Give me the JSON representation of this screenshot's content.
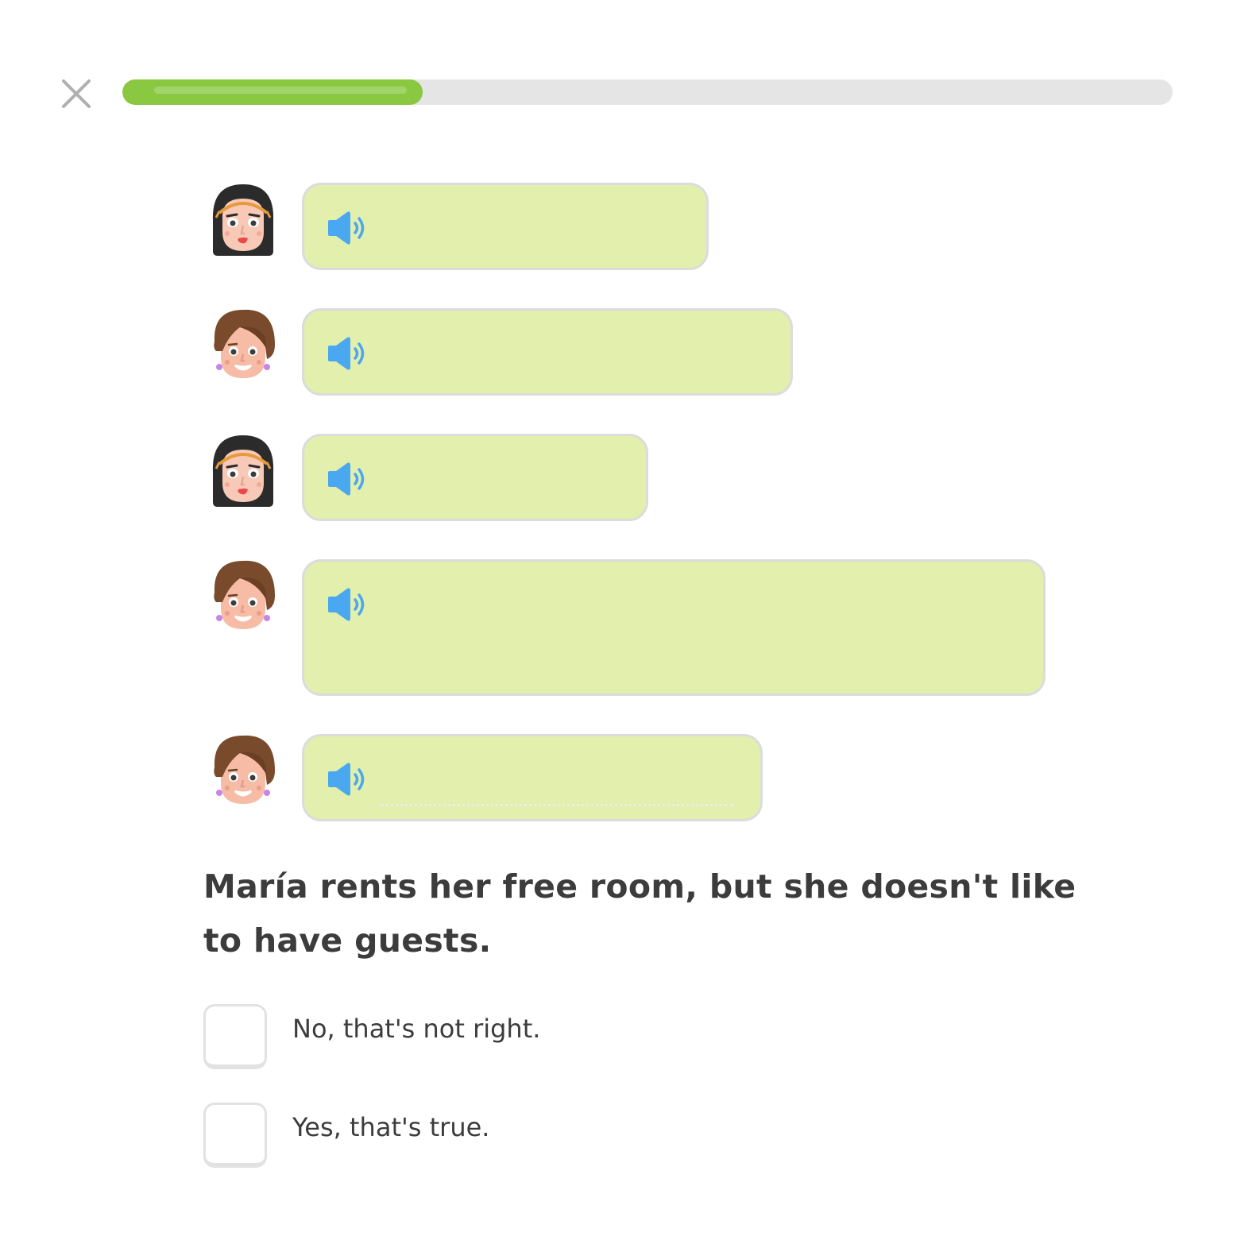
{
  "header": {
    "close_icon": "close-x-icon",
    "progress": 0.286
  },
  "colors": {
    "progress_fill": "#89c840",
    "bubble_bg": "#e3efac",
    "speaker_blue": "#4aa8f0",
    "text": "#3c3c3c"
  },
  "dialogue": [
    {
      "speaker": "dark-haired-woman",
      "icon": "speaker-icon"
    },
    {
      "speaker": "brown-haired-woman",
      "icon": "speaker-icon"
    },
    {
      "speaker": "dark-haired-woman",
      "icon": "speaker-icon"
    },
    {
      "speaker": "brown-haired-woman",
      "icon": "speaker-icon"
    },
    {
      "speaker": "brown-haired-woman",
      "icon": "speaker-icon"
    }
  ],
  "question": "María rents her free room, but she doesn't like to have guests.",
  "options": [
    {
      "label": "No, that's not right."
    },
    {
      "label": "Yes, that's true."
    }
  ]
}
